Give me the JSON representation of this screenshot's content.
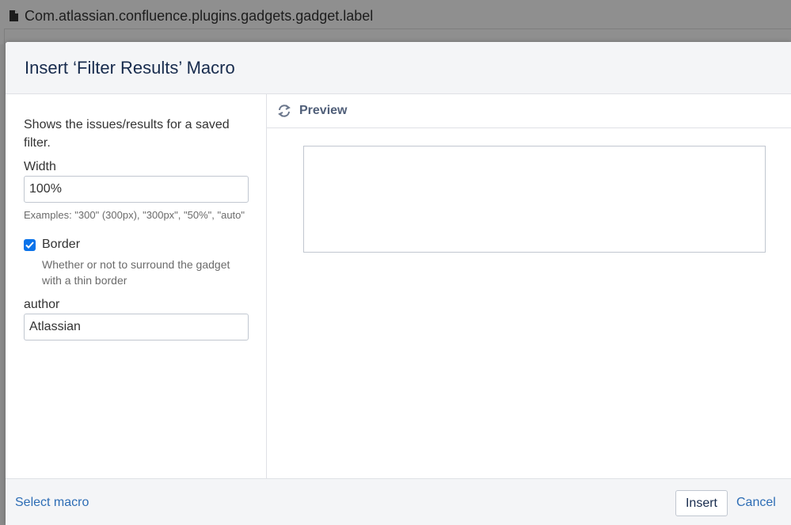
{
  "background": {
    "page_title": "Com.atlassian.confluence.plugins.gadgets.gadget.label"
  },
  "dialog": {
    "title": "Insert ‘Filter Results’ Macro",
    "description": "Shows the issues/results for a saved filter.",
    "width_field": {
      "label": "Width",
      "value": "100%",
      "hint": "Examples: \"300\" (300px), \"300px\", \"50%\", \"auto\""
    },
    "border_field": {
      "label": "Border",
      "checked": true,
      "description": "Whether or not to surround the gadget with a thin border"
    },
    "author_field": {
      "label": "author",
      "value": "Atlassian"
    },
    "preview": {
      "label": "Preview",
      "icon": "refresh-icon"
    },
    "footer": {
      "select_macro": "Select macro",
      "insert": "Insert",
      "cancel": "Cancel"
    }
  },
  "colors": {
    "link": "#2d6db5",
    "checkbox": "#0b73ea",
    "header_bg": "#f4f5f7"
  }
}
